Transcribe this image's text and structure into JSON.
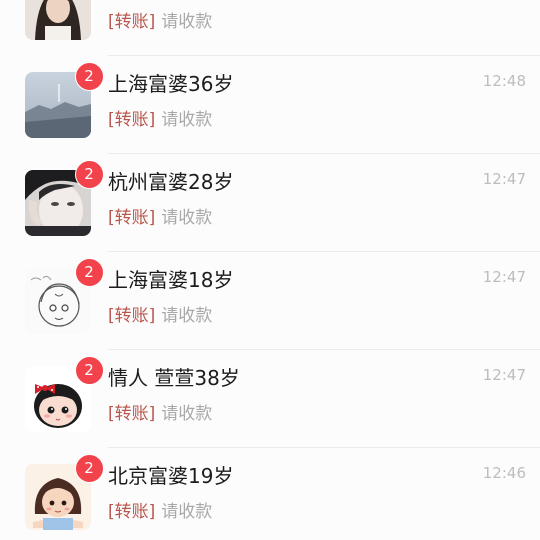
{
  "chats": [
    {
      "title": "",
      "time": "",
      "badge": "",
      "tag": "[转账]",
      "message": "请收款",
      "avatar": "woman-photo-avatar"
    },
    {
      "title": "上海富婆36岁",
      "time": "12:48",
      "badge": "2",
      "tag": "[转账]",
      "message": "请收款",
      "avatar": "sea-landscape-avatar"
    },
    {
      "title": "杭州富婆28岁",
      "time": "12:47",
      "badge": "2",
      "tag": "[转账]",
      "message": "请收款",
      "avatar": "man-selfie-avatar"
    },
    {
      "title": "上海富婆18岁",
      "time": "12:47",
      "badge": "2",
      "tag": "[转账]",
      "message": "请收款",
      "avatar": "sketch-girl-avatar"
    },
    {
      "title": "情人 萱萱38岁",
      "time": "12:47",
      "badge": "2",
      "tag": "[转账]",
      "message": "请收款",
      "avatar": "cartoon-girl-bow-avatar"
    },
    {
      "title": "北京富婆19岁",
      "time": "12:46",
      "badge": "2",
      "tag": "[转账]",
      "message": "请收款",
      "avatar": "cartoon-girl-avatar"
    }
  ],
  "colors": {
    "badge": "#f2424b",
    "tag": "#b9574d",
    "message": "#a9a9a9",
    "time": "#bdbdbd"
  }
}
